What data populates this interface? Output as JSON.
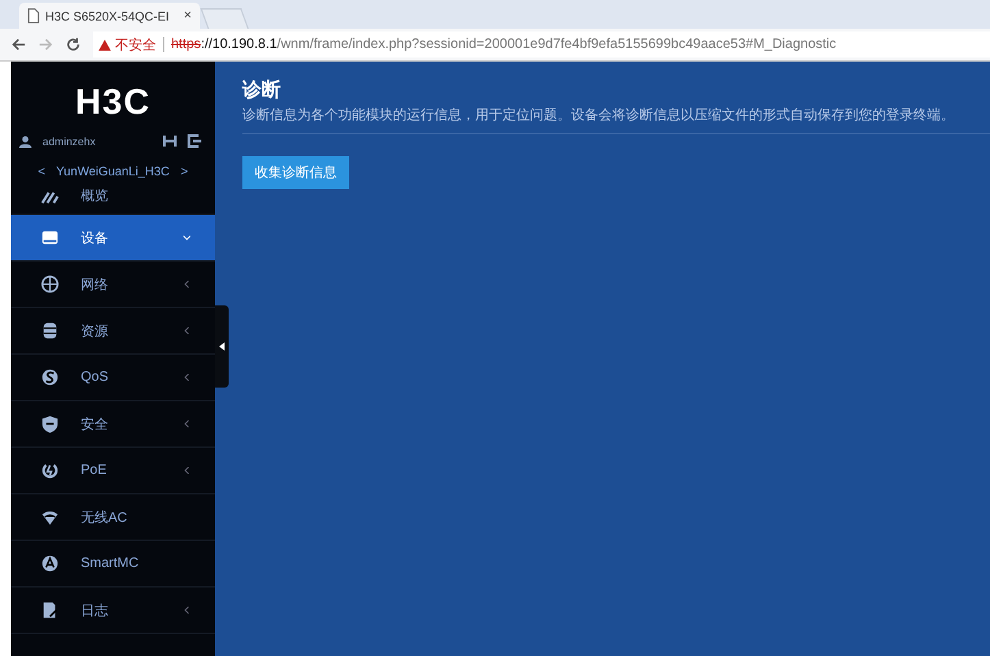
{
  "browser": {
    "tab_title": "H3C S6520X-54QC-EI",
    "tab_close": "×",
    "security_label": "不安全",
    "scheme": "https",
    "url_host": "://10.190.8.1",
    "url_path": "/wnm/frame/index.php?sessionid=200001e9d7fe4bf9efa5155699bc49aace53#M_Diagnostic"
  },
  "sidebar": {
    "logo": "H3C",
    "user": "adminzehx",
    "device_prev": "<",
    "device": "YunWeiGuanLi_H3C",
    "device_next": ">",
    "items": [
      {
        "kind": "gauge",
        "label": "概览",
        "selected": false,
        "has_arrow": false
      },
      {
        "kind": "drive",
        "label": "设备",
        "selected": true,
        "has_arrow": true
      },
      {
        "kind": "globe",
        "label": "网络",
        "selected": false,
        "has_arrow": true
      },
      {
        "kind": "database",
        "label": "资源",
        "selected": false,
        "has_arrow": true
      },
      {
        "kind": "qos",
        "label": "QoS",
        "selected": false,
        "has_arrow": true
      },
      {
        "kind": "shield",
        "label": "安全",
        "selected": false,
        "has_arrow": true
      },
      {
        "kind": "power",
        "label": "PoE",
        "selected": false,
        "has_arrow": true
      },
      {
        "kind": "wifi",
        "label": "无线AC",
        "selected": false,
        "has_arrow": false
      },
      {
        "kind": "letter",
        "label": "SmartMC",
        "selected": false,
        "has_arrow": false
      },
      {
        "kind": "log",
        "label": "日志",
        "selected": false,
        "has_arrow": true
      }
    ]
  },
  "main": {
    "title": "诊断",
    "description": "诊断信息为各个功能模块的运行信息，用于定位问题。设备会将诊断信息以压缩文件的形式自动保存到您的登录终端。",
    "button": "收集诊断信息"
  }
}
